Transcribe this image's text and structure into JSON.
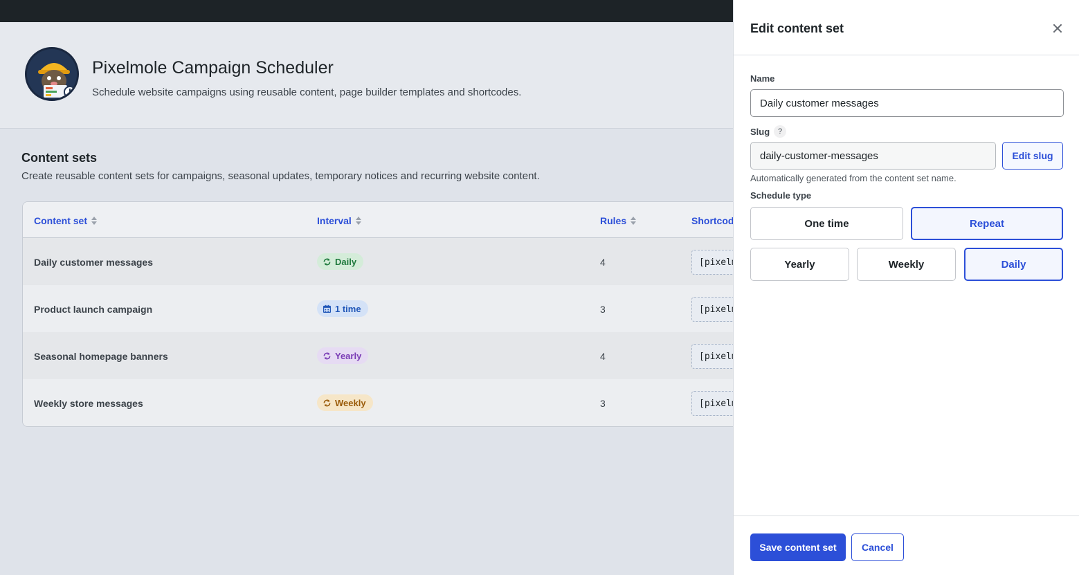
{
  "app": {
    "title": "Pixelmole Campaign Scheduler",
    "subtitle": "Schedule website campaigns using reusable content, page builder templates and shortcodes.",
    "logo_icon": "mole-mascot-logo"
  },
  "section": {
    "title": "Content sets",
    "description": "Create reusable content sets for campaigns, seasonal updates, temporary notices and recurring website content."
  },
  "table": {
    "columns": [
      "Content set",
      "Interval",
      "Rules",
      "Shortcod"
    ],
    "rows": [
      {
        "name": "Daily customer messages",
        "interval": "Daily",
        "interval_icon": "repeat-icon",
        "interval_color": "green",
        "rules": "4",
        "shortcode": "[pixelm"
      },
      {
        "name": "Product launch campaign",
        "interval": "1 time",
        "interval_icon": "calendar-icon",
        "interval_color": "blue",
        "rules": "3",
        "shortcode": "[pixelm"
      },
      {
        "name": "Seasonal homepage banners",
        "interval": "Yearly",
        "interval_icon": "repeat-icon",
        "interval_color": "purple",
        "rules": "4",
        "shortcode": "[pixelm"
      },
      {
        "name": "Weekly store messages",
        "interval": "Weekly",
        "interval_icon": "repeat-icon",
        "interval_color": "orange",
        "rules": "3",
        "shortcode": "[pixelm"
      }
    ]
  },
  "panel": {
    "title": "Edit content set",
    "name_label": "Name",
    "name_value": "Daily customer messages",
    "slug_label": "Slug",
    "slug_help": "?",
    "slug_value": "daily-customer-messages",
    "edit_slug_label": "Edit slug",
    "slug_hint": "Automatically generated from the content set name.",
    "schedule_type_label": "Schedule type",
    "schedule_types": [
      "One time",
      "Repeat"
    ],
    "schedule_type_selected": "Repeat",
    "intervals": [
      "Yearly",
      "Weekly",
      "Daily"
    ],
    "interval_selected": "Daily",
    "save_label": "Save content set",
    "cancel_label": "Cancel"
  },
  "colors": {
    "accent": "#2c4fd8",
    "topbar": "#1d2327"
  }
}
